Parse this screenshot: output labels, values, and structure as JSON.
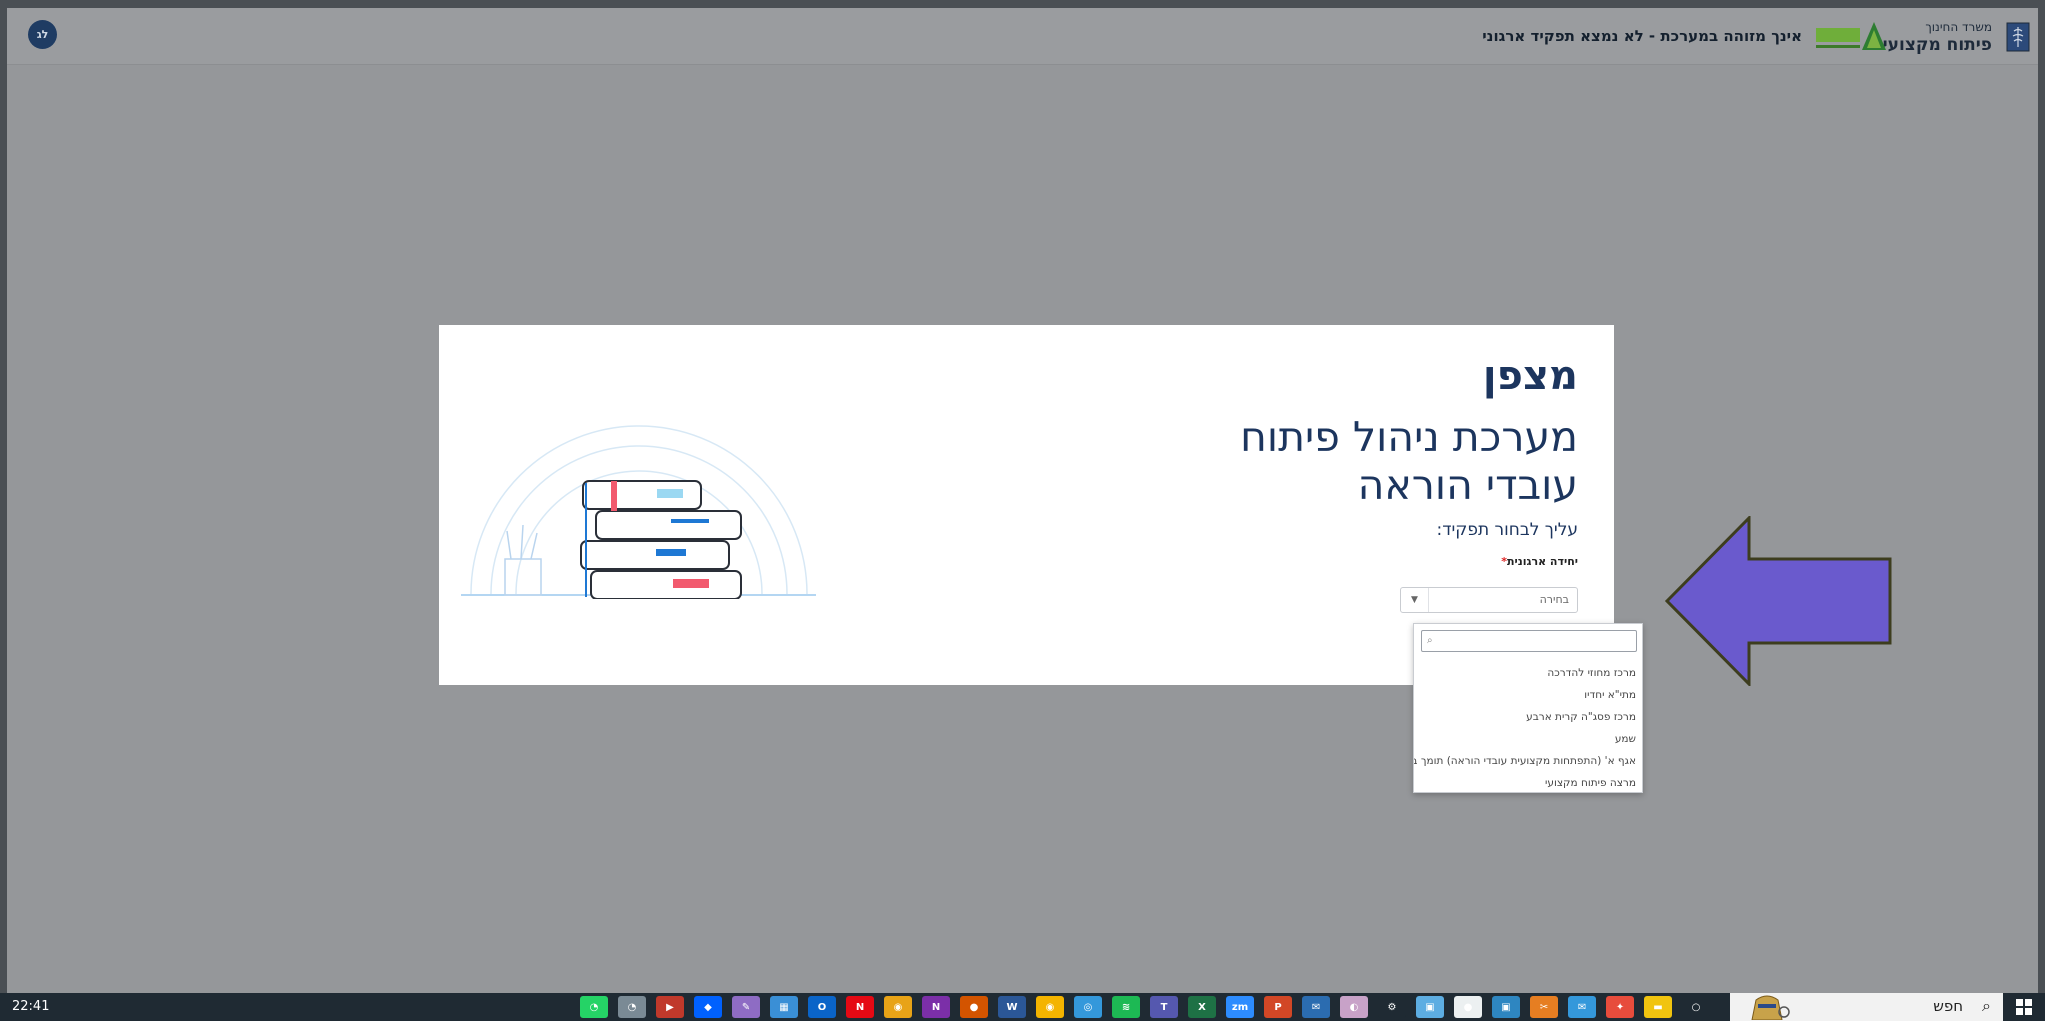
{
  "header": {
    "ministry_small": "משרד החינוך",
    "ministry_big": "פיתוח מקצועי",
    "status_text": "אינך מזוהה במערכת - לא נמצא תפקיד ארגוני",
    "user_initials": "לג"
  },
  "card": {
    "brand": "מצפן",
    "title_line1": "מערכת ניהול פיתוח",
    "title_line2": "עובדי הוראה",
    "subtitle": "עליך לבחור תפקיד:",
    "field_label": "יחידה ארגונית",
    "required_mark": "*",
    "select_value": "בחירה"
  },
  "dropdown": {
    "search_value": "",
    "options": [
      "מרכז מחוזי להדרכה",
      "מתי\"א יחדיו",
      "מרכז פסג\"ה קרית ארבע",
      "שמע",
      "אגף א' (התפתחות מקצועית עובדי הוראה) תומך בכיר",
      "מרצה פיתוח מקצועי"
    ]
  },
  "taskbar": {
    "search_label": "חפש",
    "clock": "22:41",
    "icons": [
      {
        "name": "whatsapp-icon",
        "color": "#25d366",
        "glyph": "◔"
      },
      {
        "name": "whatsapp-business-icon",
        "color": "#7a8a95",
        "glyph": "◔"
      },
      {
        "name": "media-player-icon",
        "color": "#c0392b",
        "glyph": "▶"
      },
      {
        "name": "dropbox-icon",
        "color": "#0061fe",
        "glyph": "◆"
      },
      {
        "name": "feather-icon",
        "color": "#8e6cc4",
        "glyph": "✎"
      },
      {
        "name": "control-panel-icon",
        "color": "#3a8fd6",
        "glyph": "▦"
      },
      {
        "name": "outlook-icon",
        "color": "#0a64c8",
        "glyph": "O"
      },
      {
        "name": "netflix-icon",
        "color": "#e50914",
        "glyph": "N"
      },
      {
        "name": "chrome-icon",
        "color": "#e8a317",
        "glyph": "◉"
      },
      {
        "name": "onenote-icon",
        "color": "#7b2fa8",
        "glyph": "N"
      },
      {
        "name": "app-icon-orange",
        "color": "#d35400",
        "glyph": "●"
      },
      {
        "name": "word-icon",
        "color": "#2b5797",
        "glyph": "W"
      },
      {
        "name": "chrome-active-icon",
        "color": "#f4b400",
        "glyph": "◉"
      },
      {
        "name": "app-icon-blue",
        "color": "#3498db",
        "glyph": "◎"
      },
      {
        "name": "spotify-icon",
        "color": "#1db954",
        "glyph": "≋"
      },
      {
        "name": "teams-icon",
        "color": "#5558af",
        "glyph": "T"
      },
      {
        "name": "excel-icon",
        "color": "#1e7145",
        "glyph": "X"
      },
      {
        "name": "zoom-icon",
        "color": "#2d8cff",
        "glyph": "zm"
      },
      {
        "name": "powerpoint-icon",
        "color": "#d24726",
        "glyph": "P"
      },
      {
        "name": "mail-icon",
        "color": "#2b6cb0",
        "glyph": "✉"
      },
      {
        "name": "eraser-icon",
        "color": "#c8a2c8",
        "glyph": "◐"
      },
      {
        "name": "settings-icon",
        "color": "#1f2a33",
        "glyph": "⚙"
      },
      {
        "name": "app-icon-lightblue",
        "color": "#5dade2",
        "glyph": "▣"
      },
      {
        "name": "record-icon",
        "color": "#ecf0f1",
        "glyph": "●"
      },
      {
        "name": "app-icon-window",
        "color": "#2e86c1",
        "glyph": "▣"
      },
      {
        "name": "app-icon-tools",
        "color": "#e67e22",
        "glyph": "✂"
      },
      {
        "name": "mail-app-icon",
        "color": "#3498db",
        "glyph": "✉"
      },
      {
        "name": "app-icon-colorful",
        "color": "#e74c3c",
        "glyph": "✦"
      },
      {
        "name": "file-explorer-icon",
        "color": "#f1c40f",
        "glyph": "▬"
      },
      {
        "name": "cortana-icon",
        "color": "#1f2a33",
        "glyph": "○"
      }
    ]
  },
  "colors": {
    "brand_navy": "#1c355e",
    "arrow_fill": "#6a5acd",
    "overlay_gray": "#95979a"
  }
}
